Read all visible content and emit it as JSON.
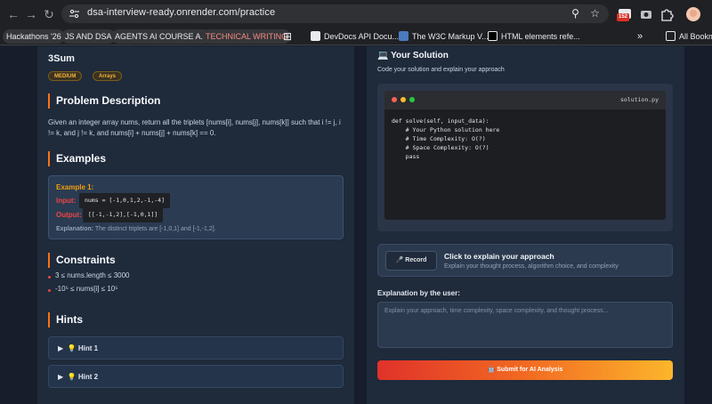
{
  "browser": {
    "url": "dsa-interview-ready.onrender.com/practice",
    "badge_count": "152",
    "bookmarks": [
      {
        "label": "Hackathons '26"
      },
      {
        "label": "JS AND DSA"
      },
      {
        "label": "AGENTS AI COURSE A..."
      },
      {
        "label": "TECHNICAL WRITING"
      },
      {
        "label": "DevDocs API Docu..."
      },
      {
        "label": "The W3C Markup V..."
      },
      {
        "label": "HTML elements refe..."
      }
    ],
    "overflow_label": "»",
    "all_bookmarks": "All Bookma"
  },
  "problem": {
    "title": "3Sum",
    "difficulty": "MEDIUM",
    "topic": "Arrays",
    "description_heading": "Problem Description",
    "description": "Given an integer array nums, return all the triplets [nums[i], nums[j], nums[k]] such that i != j, i != k, and j != k, and nums[i] + nums[j] + nums[k] == 0.",
    "examples_heading": "Examples",
    "example": {
      "title": "Example 1:",
      "input_label": "Input:",
      "input_value": "nums = [-1,0,1,2,-1,-4]",
      "output_label": "Output:",
      "output_value": "[[-1,-1,2],[-1,0,1]]",
      "explanation_label": "Explanation:",
      "explanation_text": "The distinct triplets are [-1,0,1] and [-1,-1,2]."
    },
    "constraints_heading": "Constraints",
    "constraints": [
      "3 ≤ nums.length ≤ 3000",
      "-10⁵ ≤ nums[i] ≤ 10⁵"
    ],
    "hints_heading": "Hints",
    "hints": [
      "Hint 1",
      "Hint 2"
    ]
  },
  "solution": {
    "heading": "Your Solution",
    "subheading": "Code your solution and explain your approach",
    "filename": "solution.py",
    "code": "def solve(self, input_data):\n    # Your Python solution here\n    # Time Complexity: O(?)\n    # Space Complexity: O(?)\n    pass",
    "record_label": "Record",
    "record_title": "Click to explain your approach",
    "record_subtitle": "Explain your thought process, algorithm choice, and complexity",
    "explanation_label": "Explanation by the user:",
    "explanation_placeholder": "Explain your approach, time complexity, space complexity, and thought process...",
    "submit_label": "Submit for AI Analysis"
  },
  "colors": {
    "accent_orange": "#f97316",
    "label_red": "#ef4444",
    "example_title": "#f59e0b"
  }
}
